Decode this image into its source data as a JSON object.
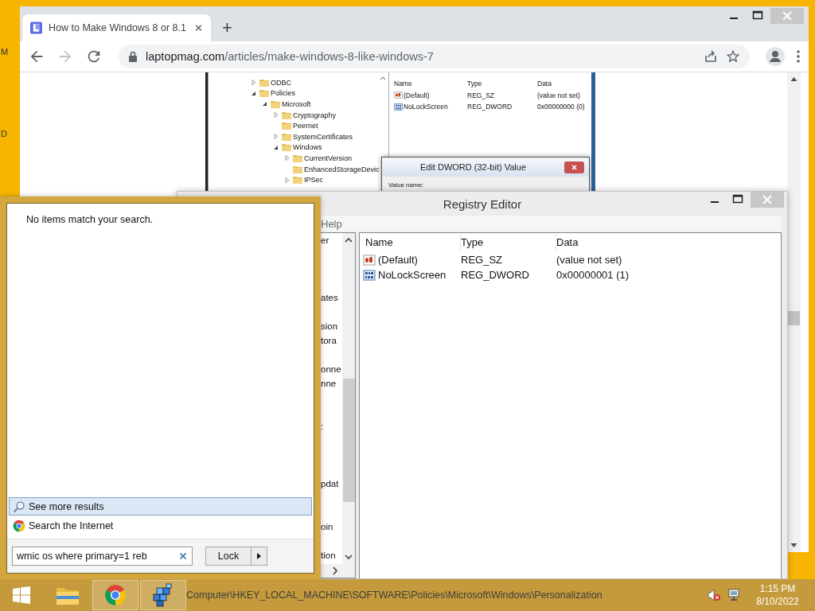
{
  "desktop": {
    "icon_labels": [
      "M",
      "D"
    ]
  },
  "browser": {
    "tab": {
      "title": "How to Make Windows 8 or 8.1",
      "selected": true
    },
    "new_tab": "+",
    "address": {
      "host": "laptopmag.com",
      "path": "/articles/make-windows-8-like-windows-7"
    },
    "article_screenshot": {
      "tree": [
        {
          "label": "ODBC",
          "expanded": false
        },
        {
          "label": "Policies",
          "expanded": true,
          "children": [
            {
              "label": "Microsoft",
              "expanded": true,
              "children": [
                {
                  "label": "Cryptography",
                  "expanded": false
                },
                {
                  "label": "Peernet"
                },
                {
                  "label": "SystemCertificates",
                  "expanded": false
                },
                {
                  "label": "Windows",
                  "expanded": true,
                  "children": [
                    {
                      "label": "CurrentVersion",
                      "expanded": false
                    },
                    {
                      "label": "EnhancedStorageDevic"
                    },
                    {
                      "label": "IPSec",
                      "expanded": false
                    }
                  ]
                }
              ]
            }
          ]
        }
      ],
      "columns": [
        "Name",
        "Type",
        "Data"
      ],
      "rows": [
        {
          "kind": "string",
          "name": "(Default)",
          "type": "REG_SZ",
          "data": "(value not set)"
        },
        {
          "kind": "dword",
          "name": "NoLockScreen",
          "type": "REG_DWORD",
          "data": "0x00000000 (0)"
        }
      ],
      "dialog": {
        "title": "Edit DWORD (32-bit) Value",
        "field_label": "Value name:"
      }
    }
  },
  "registry_editor": {
    "title": "Registry Editor",
    "menu": [
      "Help"
    ],
    "tree_fragments": [
      "er",
      "ates",
      "sion",
      "tora",
      "onne",
      "nne",
      ":",
      "pdat",
      "oin",
      "tion"
    ],
    "columns": [
      "Name",
      "Type",
      "Data"
    ],
    "rows": [
      {
        "kind": "string",
        "name": "(Default)",
        "type": "REG_SZ",
        "data": "(value not set)"
      },
      {
        "kind": "dword",
        "name": "NoLockScreen",
        "type": "REG_DWORD",
        "data": "0x00000001 (1)"
      }
    ],
    "status_path": "Computer\\HKEY_LOCAL_MACHINE\\SOFTWARE\\Policies\\Microsoft\\Windows\\Personalization"
  },
  "start_menu": {
    "message": "No items match your search.",
    "results": [
      {
        "kind": "search",
        "label": "See more results",
        "selected": true
      },
      {
        "kind": "web",
        "label": "Search the Internet",
        "selected": false
      }
    ],
    "search": {
      "value": "wmic os where primary=1 reb"
    },
    "power_button": "Lock"
  },
  "taskbar": {
    "apps": [
      {
        "kind": "explorer",
        "running": false
      },
      {
        "kind": "chrome",
        "running": true
      },
      {
        "kind": "regedit",
        "running": true
      }
    ],
    "clock": {
      "time": "1:15 PM",
      "date": "8/10/2022"
    }
  }
}
